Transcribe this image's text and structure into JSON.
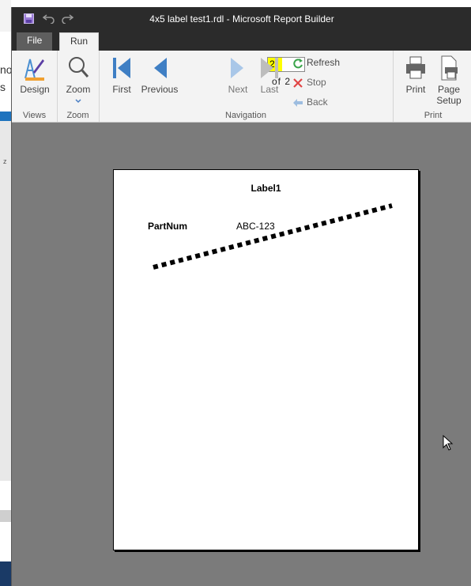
{
  "background_app": {
    "text_line1": "no",
    "text_line2": "s",
    "text_line3": "z"
  },
  "window": {
    "title": "4x5 label test1.rdl - Microsoft Report Builder"
  },
  "tabs": [
    {
      "label": "File"
    },
    {
      "label": "Run"
    }
  ],
  "ribbon": {
    "views": {
      "group_label": "Views",
      "design_label": "Design"
    },
    "zoom": {
      "group_label": "Zoom",
      "zoom_label": "Zoom"
    },
    "navigation": {
      "group_label": "Navigation",
      "first_label": "First",
      "previous_label": "Previous",
      "current_page": "2",
      "of_pages": "of 2",
      "next_label": "Next",
      "last_label": "Last",
      "refresh_label": "Refresh",
      "stop_label": "Stop",
      "back_label": "Back"
    },
    "print": {
      "group_label": "Print",
      "print_label": "Print",
      "page_setup_label": "Page Setup"
    }
  },
  "report": {
    "title": "Label1",
    "field_label": "PartNum",
    "field_value": "ABC-123"
  },
  "colors": {
    "highlight": "#ffff00",
    "nav_blue": "#3f7fc4",
    "title_bar": "#2b2b2b"
  }
}
